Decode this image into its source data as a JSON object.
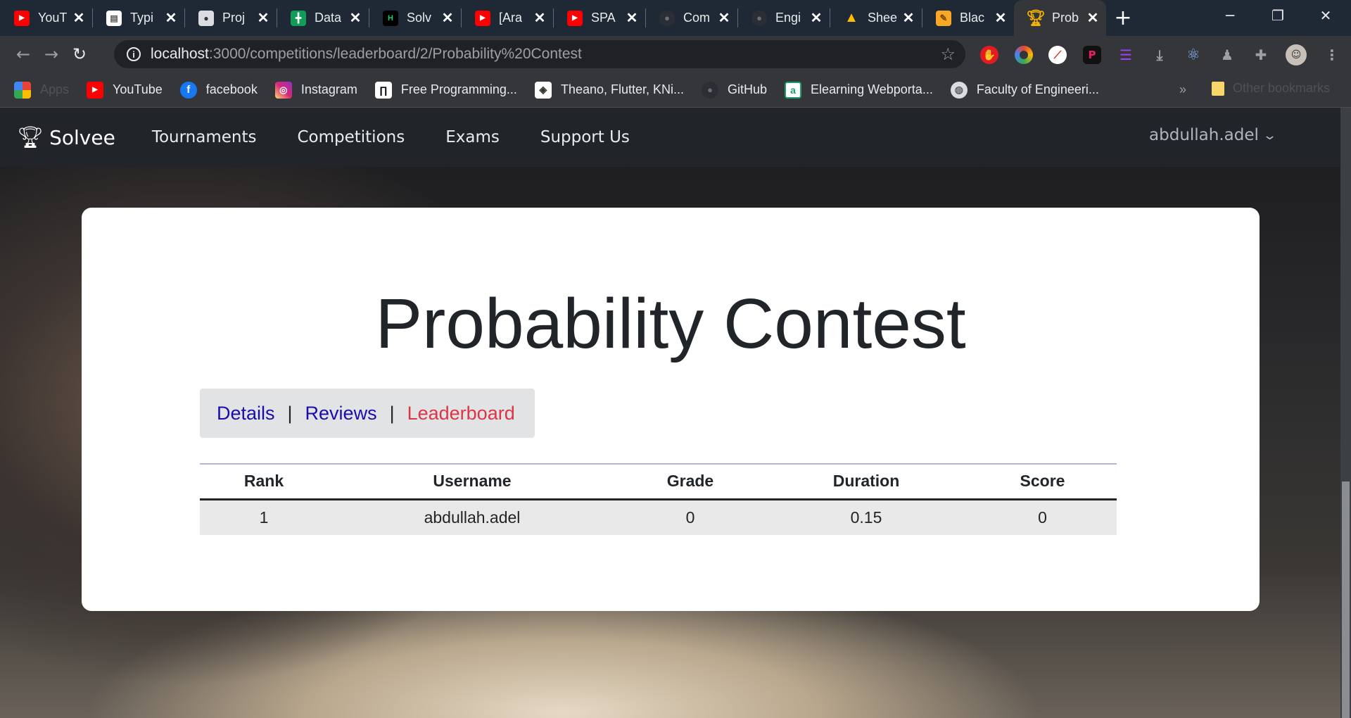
{
  "browser": {
    "tabs": [
      {
        "title": "YouT",
        "icon": "youtube-icon",
        "color": "#ff0000"
      },
      {
        "title": "Typi",
        "icon": "document-icon",
        "color": "#ffffff"
      },
      {
        "title": "Proj",
        "icon": "classroom-icon",
        "color": "#dadce0"
      },
      {
        "title": "Data",
        "icon": "sheets-icon",
        "color": "#0f9d58"
      },
      {
        "title": "Solv",
        "icon": "hackerrank-icon",
        "color": "#000000"
      },
      {
        "title": "[Ara",
        "icon": "youtube-icon",
        "color": "#ff0000"
      },
      {
        "title": "SPA",
        "icon": "youtube-icon",
        "color": "#ff0000"
      },
      {
        "title": "Com",
        "icon": "github-icon",
        "color": "#2b2f35"
      },
      {
        "title": "Engi",
        "icon": "github-icon",
        "color": "#2b2f35"
      },
      {
        "title": "Shee",
        "icon": "drive-icon",
        "color": "#fbbc04"
      },
      {
        "title": "Blac",
        "icon": "pencil-icon",
        "color": "#f9a825"
      },
      {
        "title": "Prob",
        "icon": "trophy-icon",
        "color": "#f4b400",
        "active": true
      }
    ],
    "address": {
      "host": "localhost",
      "path": ":3000/competitions/leaderboard/2/Probability%20Contest"
    },
    "bookmarks": [
      {
        "label": "Apps",
        "icon": "apps-grid-icon",
        "dim": true
      },
      {
        "label": "YouTube",
        "icon": "youtube-icon"
      },
      {
        "label": "facebook",
        "icon": "facebook-icon"
      },
      {
        "label": "Instagram",
        "icon": "instagram-icon"
      },
      {
        "label": "Free Programming...",
        "icon": "freecodecamp-icon"
      },
      {
        "label": "Theano, Flutter, KNi...",
        "icon": "theano-icon"
      },
      {
        "label": "GitHub",
        "icon": "github-icon"
      },
      {
        "label": "Elearning Webporta...",
        "icon": "elearning-icon"
      },
      {
        "label": "Faculty of Engineeri...",
        "icon": "globe-icon"
      }
    ],
    "bookmarks_overflow": "»",
    "other_bookmarks": "Other bookmarks"
  },
  "site": {
    "brand": "Solvee",
    "nav": [
      "Tournaments",
      "Competitions",
      "Exams",
      "Support Us"
    ],
    "user": "abdullah.adel"
  },
  "contest": {
    "title": "Probability Contest",
    "tabs": [
      {
        "label": "Details",
        "active": false
      },
      {
        "label": "Reviews",
        "active": false
      },
      {
        "label": "Leaderboard",
        "active": true
      }
    ],
    "leaderboard": {
      "columns": [
        "Rank",
        "Username",
        "Grade",
        "Duration",
        "Score"
      ],
      "rows": [
        [
          "1",
          "abdullah.adel",
          "0",
          "0.15",
          "0"
        ]
      ]
    }
  }
}
